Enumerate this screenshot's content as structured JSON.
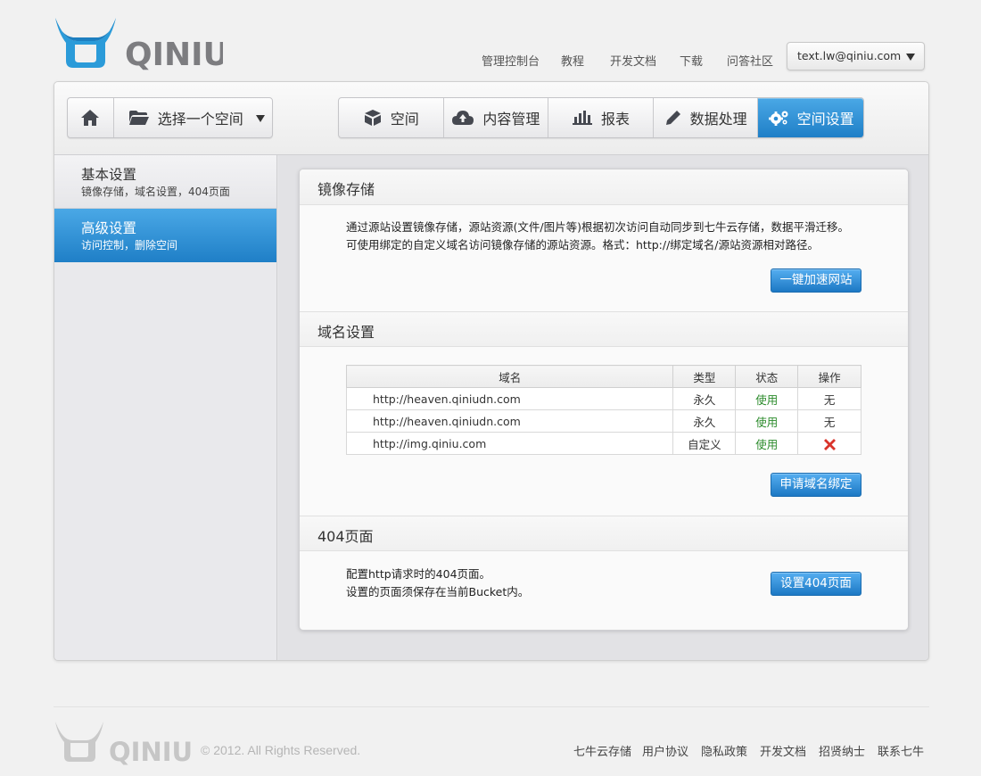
{
  "brand": {
    "name": "QINIU"
  },
  "topnav": {
    "links": [
      "管理控制台",
      "教程",
      "开发文档",
      "下载",
      "问答社区"
    ],
    "account_email": "text.lw@qiniu.com"
  },
  "toolbar": {
    "bucket_select_label": "选择一个空间",
    "tabs": [
      "空间",
      "内容管理",
      "报表",
      "数据处理",
      "空间设置"
    ],
    "active_tab": "空间设置"
  },
  "sidebar": {
    "items": [
      {
        "title": "基本设置",
        "subtitle": "镜像存储，域名设置，404页面"
      },
      {
        "title": "高级设置",
        "subtitle": "访问控制，删除空间"
      }
    ],
    "active": "高级设置"
  },
  "mirror": {
    "heading": "镜像存储",
    "line1": "通过源站设置镜像存储，源站资源(文件/图片等)根据初次访问自动同步到七牛云存储，数据平滑迁移。",
    "line2": "可使用绑定的自定义域名访问镜像存储的源站资源。格式：http://绑定域名/源站资源相对路径。",
    "button": "一键加速网站"
  },
  "domains": {
    "heading": "域名设置",
    "columns": [
      "域名",
      "类型",
      "状态",
      "操作"
    ],
    "rows": [
      {
        "domain": "http://heaven.qiniudn.com",
        "type": "永久",
        "status": "使用",
        "action": "无"
      },
      {
        "domain": "http://heaven.qiniudn.com",
        "type": "永久",
        "status": "使用",
        "action": "无"
      },
      {
        "domain": "http://img.qiniu.com",
        "type": "自定义",
        "status": "使用",
        "action": "delete-icon"
      }
    ],
    "button": "申请域名绑定"
  },
  "page404": {
    "heading": "404页面",
    "line1": "配置http请求时的404页面。",
    "line2": "设置的页面须保存在当前Bucket内。",
    "button": "设置404页面"
  },
  "footer": {
    "copyright": "© 2012. All Rights Reserved.",
    "links": [
      "七牛云存储",
      "用户协议",
      "隐私政策",
      "开发文档",
      "招贤纳士",
      "联系七牛"
    ]
  },
  "colors": {
    "accent": "#2b8bd6",
    "ok_green": "#2a8a2a",
    "delete_red": "#d9342b"
  }
}
